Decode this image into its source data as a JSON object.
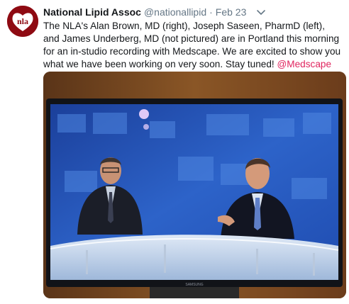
{
  "account": {
    "name": "National Lipid Assoc",
    "handle": "@nationallipid",
    "separator": "·",
    "time": "Feb 23",
    "avatar_text": "nla"
  },
  "tweet": {
    "text": "The NLA's Alan Brown, MD (right), Joseph Saseen, PharmD (left), and James Underberg, MD (not pictured) are in Portland this morning for an in-studio recording with Medscape. We are excited to show you what we have been working on very soon. Stay tuned! ",
    "mention": "@Medscape"
  },
  "media": {
    "description_icon": "photo",
    "tv_brand": "SAMSUNG"
  },
  "icons": {
    "menu": "chevron-down-icon",
    "avatar": "nla-logo-icon"
  },
  "colors": {
    "mention": "#e0245e",
    "secondary_text": "#657786",
    "logo_red": "#8e0a12"
  }
}
